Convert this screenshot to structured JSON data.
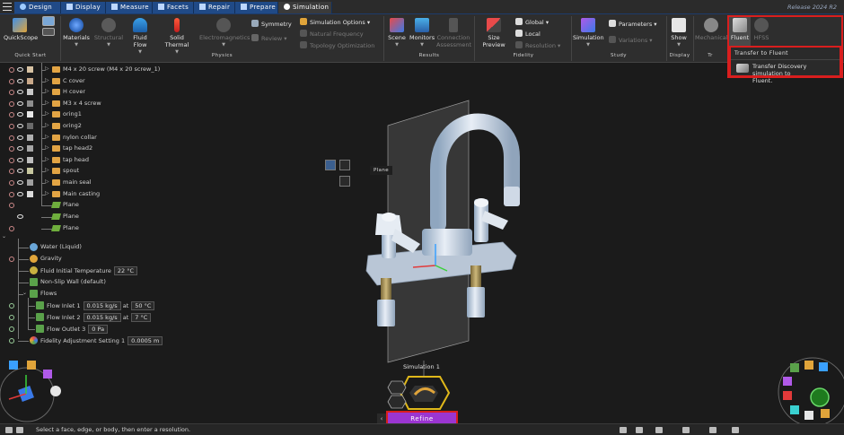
{
  "app": {
    "release": "Release 2024 R2"
  },
  "tabs": [
    {
      "label": "Design",
      "icon": "pencil-icon"
    },
    {
      "label": "Display",
      "icon": "brush-icon"
    },
    {
      "label": "Measure",
      "icon": "ruler-icon"
    },
    {
      "label": "Facets",
      "icon": "facets-icon"
    },
    {
      "label": "Repair",
      "icon": "wrench-icon"
    },
    {
      "label": "Prepare",
      "icon": "prepare-icon"
    },
    {
      "label": "Simulation",
      "icon": "simulation-icon",
      "active": true
    }
  ],
  "ribbon": {
    "quickstart": {
      "label": "QuickScope",
      "group": "Quick Start"
    },
    "physics": {
      "materials": "Materials",
      "structural": "Structural",
      "fluid_flow": "Fluid Flow",
      "solid_thermal": "Solid Thermal",
      "electromagnetics": "Electromagnetics",
      "symmetry": "Symmetry",
      "review": "Review",
      "sim_options": "Simulation Options",
      "natural_freq": "Natural Frequency",
      "topology": "Topology Optimization",
      "group": "Physics"
    },
    "results": {
      "scene": "Scene",
      "monitors": "Monitors",
      "connection": "Connection",
      "assessment": "Assessment",
      "group": "Results"
    },
    "fidelity": {
      "size_preview": "Size Preview",
      "global": "Global",
      "local": "Local",
      "resolution": "Resolution",
      "group": "Fidelity"
    },
    "study": {
      "simulation": "Simulation",
      "parameters": "Parameters",
      "variations": "Variations",
      "group": "Study"
    },
    "display": {
      "show": "Show",
      "group": "Display"
    },
    "transfer": {
      "mechanical": "Mechanical",
      "fluent": "Fluent",
      "hfss": "HFSS",
      "group": "Tr"
    }
  },
  "tooltip": {
    "title": "Transfer to Fluent",
    "desc_line1": "Transfer Discovery simulation to",
    "desc_line2": "Fluent."
  },
  "tree": [
    {
      "label": "M4 x 20 screw (M4 x 20 screw_1)",
      "swatch": "#d7c2a3"
    },
    {
      "label": "C cover",
      "swatch": "#c9a98a"
    },
    {
      "label": "H cover",
      "swatch": "#c9c9c9"
    },
    {
      "label": "M3 x 4 screw",
      "swatch": "#8e8e8e"
    },
    {
      "label": "oring1",
      "swatch": "#e8e8e8"
    },
    {
      "label": "oring2",
      "swatch": "#6b6b6b"
    },
    {
      "label": "nylon collar",
      "swatch": "#b0b0b0"
    },
    {
      "label": "tap head2",
      "swatch": "#a6a6a6"
    },
    {
      "label": "tap head",
      "swatch": "#bdbdbd"
    },
    {
      "label": "spout",
      "swatch": "#c8c8a0"
    },
    {
      "label": "main seal",
      "swatch": "#a0a0a0"
    },
    {
      "label": "Main casting",
      "swatch": "#dcdcdc"
    }
  ],
  "planes": [
    "Plane",
    "Plane",
    "Plane"
  ],
  "sim_tree": {
    "water": "Water (Liquid)",
    "gravity": "Gravity",
    "fluid_temp_label": "Fluid Initial Temperature",
    "fluid_temp_value": "22 °C",
    "wall": "Non-Slip Wall (default)",
    "flows": "Flows",
    "inlet1": "Flow Inlet 1",
    "inlet1_rate": "0.015 kg/s",
    "inlet1_at": "at",
    "inlet1_temp": "50 °C",
    "inlet2": "Flow Inlet 2",
    "inlet2_rate": "0.015 kg/s",
    "inlet2_at": "at",
    "inlet2_temp": "7 °C",
    "outlet3": "Flow Outlet 3",
    "outlet3_pressure": "0 Pa",
    "fidelity_label": "Fidelity Adjustment Setting 1",
    "fidelity_value": "0.0005 m"
  },
  "viewport": {
    "plane_tag": "Plane",
    "simulation_label": "Simulation 1"
  },
  "refine": {
    "label": "Refine",
    "back": "‹"
  },
  "status": {
    "text": "Select a face, edge, or body, then enter a resolution."
  },
  "colors": {
    "accent_tab": "#204a87",
    "refine": "#9b35d1",
    "highlight": "#d91e1e"
  }
}
